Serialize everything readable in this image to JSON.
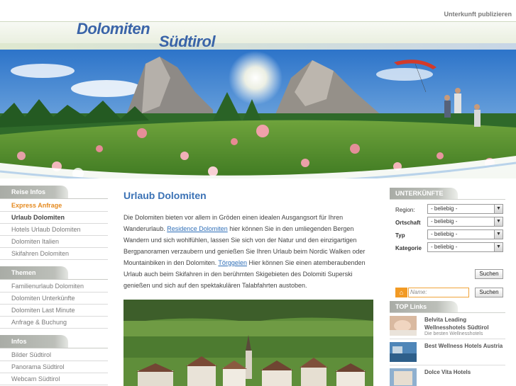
{
  "topbar": {
    "link": "Unterkunft publizieren"
  },
  "logo": {
    "line1": "Dolomiten",
    "line2": "Südtirol"
  },
  "left_nav": [
    {
      "heading": "Reise Infos",
      "items": [
        {
          "label": "Express Anfrage",
          "style": "accent"
        },
        {
          "label": "Urlaub Dolomiten",
          "style": "bold"
        },
        {
          "label": "Hotels Urlaub Dolomiten",
          "style": ""
        },
        {
          "label": "Dolomiten Italien",
          "style": ""
        },
        {
          "label": "Skifahren Dolomiten",
          "style": ""
        }
      ]
    },
    {
      "heading": "Themen",
      "items": [
        {
          "label": "Familienurlaub Dolomiten",
          "style": ""
        },
        {
          "label": "Dolomiten Unterkünfte",
          "style": ""
        },
        {
          "label": "Dolomiten Last Minute",
          "style": ""
        },
        {
          "label": "Anfrage & Buchung",
          "style": ""
        }
      ]
    },
    {
      "heading": "Infos",
      "items": [
        {
          "label": "Bilder Südtirol",
          "style": ""
        },
        {
          "label": "Panorama Südtirol",
          "style": ""
        },
        {
          "label": "Webcam Südtirol",
          "style": ""
        }
      ]
    }
  ],
  "main": {
    "title": "Urlaub Dolomiten",
    "p_part1": "Die Dolomiten bieten vor allem in Gröden einen idealen Ausgangsort für Ihren Wanderurlaub. ",
    "link1": "Residence Dolomiten",
    "p_part2": " hier können Sie in den umliegenden Bergen Wandern und sich wohlfühlen, lassen Sie sich von der Natur und den einzigartigen Bergpanoramen verzaubern und genießen Sie Ihren Urlaub beim Nordic Walken oder Mountainbiken in den Dolomiten. ",
    "link2": "Törggelen",
    "p_part3": " Hier können Sie einen atemberaubenden Urlaub auch beim Skifahren in den berühmten Skigebieten des Dolomiti Superski genießen und sich auf den spektakulären Talabfahrten austoben."
  },
  "unterkuenfte": {
    "heading": "UNTERKÜNFTE",
    "fields": [
      {
        "label": "Region:",
        "value": "- beliebig -",
        "bold": false
      },
      {
        "label": "Ortschaft",
        "value": "- beliebig -",
        "bold": true
      },
      {
        "label": "Typ",
        "value": "- beliebig -",
        "bold": true
      },
      {
        "label": "Kategorie",
        "value": "- beliebig -",
        "bold": true
      }
    ],
    "search_label": "Suchen",
    "name_placeholder": "Name:",
    "search_label2": "Suchen"
  },
  "toplinks": {
    "heading": "TOP Links",
    "items": [
      {
        "title": "Belvita Leading Wellnesshotels Südtirol",
        "sub": "Die besten Wellnesshotels"
      },
      {
        "title": "Best Wellness Hotels Austria",
        "sub": ""
      },
      {
        "title": "Dolce Vita Hotels",
        "sub": ""
      }
    ]
  },
  "colors": {
    "accent_blue": "#3b72b5",
    "link_blue": "#2f6fb8",
    "orange": "#e58a1f"
  },
  "icons": {
    "search_home": "house-icon",
    "dropdown": "chevron-down-icon"
  }
}
